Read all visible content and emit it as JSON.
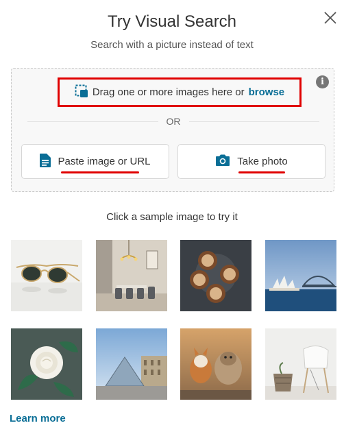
{
  "dialog": {
    "title": "Try Visual Search",
    "subtitle": "Search with a picture instead of text"
  },
  "upload": {
    "drag_text": "Drag one or more images here or",
    "browse_label": "browse",
    "or_label": "OR",
    "paste_label": "Paste image or URL",
    "take_photo_label": "Take photo"
  },
  "samples": {
    "prompt": "Click a sample image to try it",
    "images": [
      {
        "name": "sample-sunglasses"
      },
      {
        "name": "sample-dining-room"
      },
      {
        "name": "sample-lattes"
      },
      {
        "name": "sample-sydney-opera-house"
      },
      {
        "name": "sample-white-rose"
      },
      {
        "name": "sample-louvre-pyramid"
      },
      {
        "name": "sample-dogs-running"
      },
      {
        "name": "sample-white-chair"
      }
    ]
  },
  "footer": {
    "learn_more": "Learn more"
  },
  "colors": {
    "link": "#0a6e96",
    "annotation": "#e00000"
  },
  "icons": {
    "close": "close-icon",
    "info": "info-icon",
    "drag": "image-drop-icon",
    "paste": "document-icon",
    "camera": "camera-icon"
  }
}
